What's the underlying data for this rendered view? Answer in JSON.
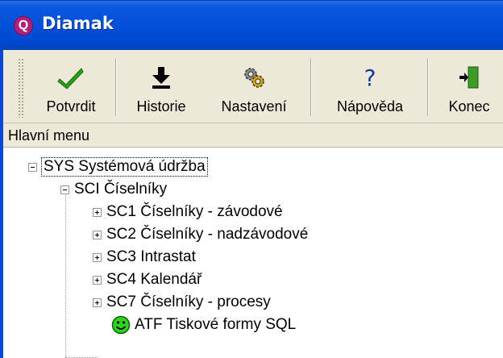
{
  "window": {
    "title": "Diamak",
    "app_icon_glyph": "Q"
  },
  "toolbar": {
    "buttons": [
      {
        "label": "Potvrdit",
        "icon": "checkmark-icon"
      },
      {
        "label": "Historie",
        "icon": "download-arrow-icon"
      },
      {
        "label": "Nastavení",
        "icon": "gears-icon"
      },
      {
        "label": "Nápověda",
        "icon": "question-mark-icon"
      },
      {
        "label": "Konec",
        "icon": "exit-door-icon"
      }
    ]
  },
  "header": {
    "title": "Hlavní menu"
  },
  "tree": {
    "root": {
      "label": "SYS Systémová údržba",
      "expanded": true
    },
    "child": {
      "label": "SCI Číselníky",
      "expanded": true
    },
    "items": [
      {
        "label": "SC1 Číselníky - závodové",
        "expander": "plus"
      },
      {
        "label": "SC2 Číselníky - nadzávodové",
        "expander": "plus"
      },
      {
        "label": "SC3 Intrastat",
        "expander": "plus"
      },
      {
        "label": "SC4 Kalendář",
        "expander": "plus"
      },
      {
        "label": "SC7 Číselníky - procesy",
        "expander": "plus"
      }
    ],
    "leaf": {
      "label": "ATF Tiskové formy SQL",
      "icon": "smiley-icon"
    }
  },
  "colors": {
    "titlebar": "#0450d8",
    "toolbar_bg": "#ece9d8",
    "accent_green": "#2aa019"
  }
}
